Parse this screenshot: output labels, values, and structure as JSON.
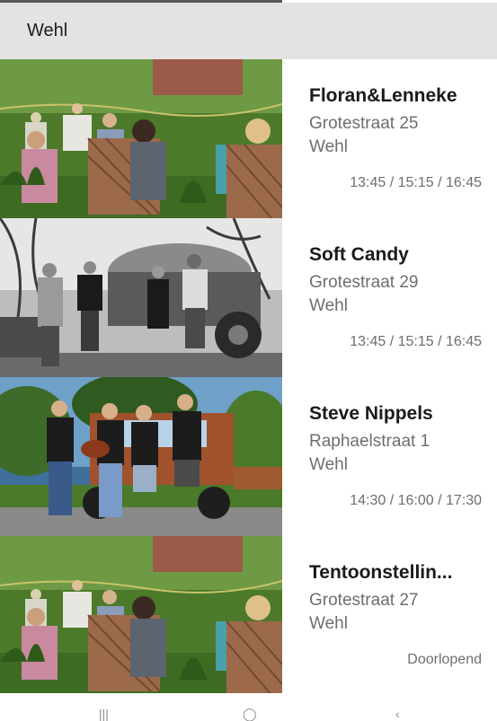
{
  "header": {
    "title": "Wehl"
  },
  "events": [
    {
      "name": "Floran&Lenneke",
      "street": "Grotestraat 25",
      "city": "Wehl",
      "times": "13:45 / 15:15 / 16:45",
      "photo": "garden-audience-photo"
    },
    {
      "name": "Soft Candy",
      "street": "Grotestraat 29",
      "city": "Wehl",
      "times": "13:45 / 15:15 / 16:45",
      "photo": "band-bw-photo"
    },
    {
      "name": "Steve Nippels",
      "street": "Raphaelstraat 1",
      "city": "Wehl",
      "times": "14:30 / 16:00 / 17:30",
      "photo": "band-truck-photo"
    },
    {
      "name": "Tentoonstellin...",
      "street": "Grotestraat 27",
      "city": "Wehl",
      "times": "Doorlopend",
      "photo": "garden-audience-photo"
    }
  ],
  "colors": {
    "header_bg": "#e3e3e3",
    "name": "#1a1a1a",
    "secondary": "#6e6e6e"
  }
}
